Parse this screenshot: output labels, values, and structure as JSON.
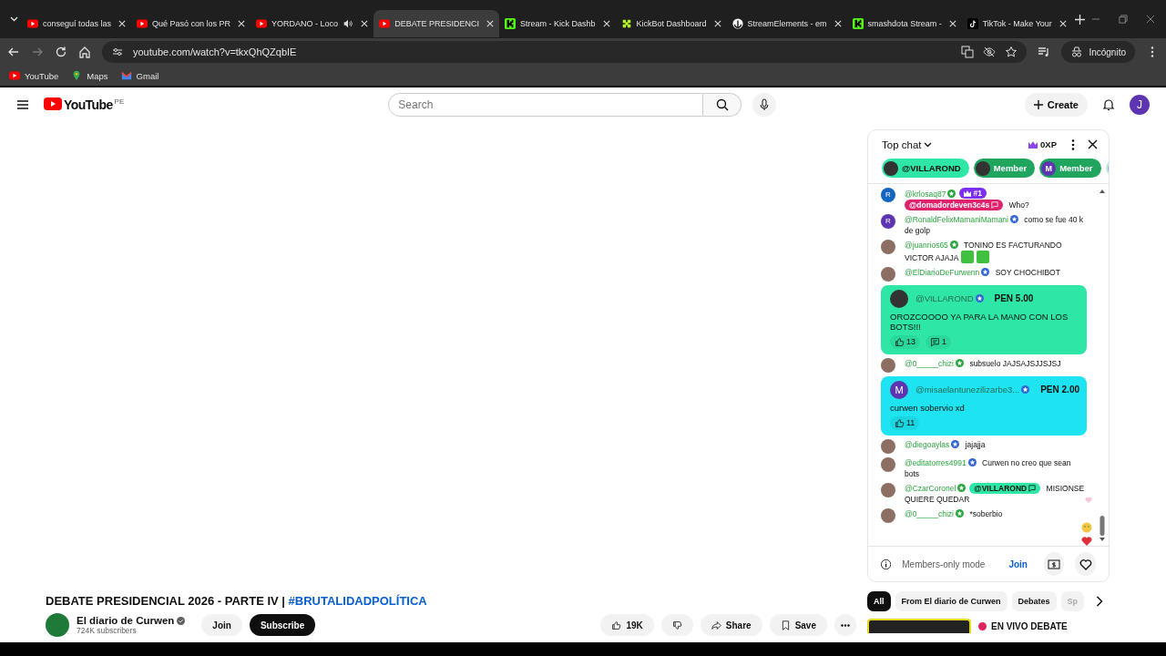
{
  "browser": {
    "tabs": [
      {
        "title": "conseguí todas las",
        "kind": "youtube",
        "audio": false,
        "selected": false
      },
      {
        "title": "Qué Pasó con los PR",
        "kind": "youtube",
        "audio": false,
        "selected": false
      },
      {
        "title": "YORDANO - Loco",
        "kind": "youtube",
        "audio": true,
        "selected": false
      },
      {
        "title": "DEBATE PRESIDENCI",
        "kind": "youtube",
        "audio": false,
        "selected": true
      },
      {
        "title": "Stream - Kick Dashb",
        "kind": "kick",
        "audio": false,
        "selected": false
      },
      {
        "title": "KickBot Dashboard",
        "kind": "kickbot",
        "audio": false,
        "selected": false
      },
      {
        "title": "StreamElements - em",
        "kind": "streamelements",
        "audio": false,
        "selected": false
      },
      {
        "title": "smashdota Stream -",
        "kind": "kick",
        "audio": false,
        "selected": false
      },
      {
        "title": "TikTok - Make Your",
        "kind": "tiktok",
        "audio": false,
        "selected": false
      }
    ],
    "url": "youtube.com/watch?v=tkxQhQZqbIE",
    "profile": "Incógnito",
    "bookmarks": [
      {
        "label": "YouTube",
        "kind": "youtube"
      },
      {
        "label": "Maps",
        "kind": "maps"
      },
      {
        "label": "Gmail",
        "kind": "gmail"
      }
    ]
  },
  "header": {
    "logo": "YouTube",
    "region": "PE",
    "search_placeholder": "Search",
    "create": "Create",
    "avatar_letter": "J"
  },
  "chat": {
    "title": "Top chat",
    "xp": "0XP",
    "pinned": [
      {
        "label": "@VILLAROND"
      },
      {
        "label": "Member"
      },
      {
        "label": "Member",
        "avatar_letter": "M"
      }
    ],
    "messages": [
      {
        "kind": "text",
        "author": "@krlosaq87",
        "member": true,
        "avatar": {
          "letter": "R",
          "color": "#1565c0"
        },
        "rank": "#1",
        "mention": {
          "label": "@domadordeven3c4s",
          "color": "#e0216b"
        },
        "text": "Who?"
      },
      {
        "kind": "text",
        "author": "@RonaldFelixMamaniMamani",
        "member": false,
        "avatar": {
          "letter": "R",
          "color": "#5e35b1"
        },
        "text": "como se fue 40 k de golp"
      },
      {
        "kind": "text",
        "author": "@juanrios65",
        "member": true,
        "text": "TONINO ES FACTURANDO VICTOR AJAJA",
        "emotes": true
      },
      {
        "kind": "text",
        "author": "@ElDiarioDeFurwenn",
        "member": false,
        "text": "SOY CHOCHIBOT"
      },
      {
        "kind": "superchat",
        "author": "@VILLAROND",
        "member": false,
        "amount": "PEN 5.00",
        "color": "#2ee6a6",
        "text": "OROZCOOOO YA PARA LA MANO CON LOS BOTS!!!",
        "likes": "13",
        "replies": "1"
      },
      {
        "kind": "text",
        "author": "@0_____chizi",
        "member": true,
        "text": "subsuelo JAJSAJSJJSJSJ"
      },
      {
        "kind": "superchat",
        "author": "@misaelantunezilizarbe3...",
        "member": false,
        "avatar": {
          "letter": "M",
          "color": "#5e35b1"
        },
        "amount": "PEN 2.00",
        "color": "#1de4f0",
        "text": "curwen sobervio xd",
        "likes": "11"
      },
      {
        "kind": "text",
        "author": "@diegoaylas",
        "member": false,
        "text": "jajajja"
      },
      {
        "kind": "text",
        "author": "@editatorres4991",
        "member": false,
        "text": "Curwen no creo que sean bots"
      },
      {
        "kind": "text",
        "author": "@CzarCoronel",
        "member": true,
        "mention": {
          "label": "@VILLAROND",
          "color": "#2ee6a6"
        },
        "text": "MISIONSE QUIERE QUEDAR"
      },
      {
        "kind": "text",
        "author": "@0_____chizi",
        "member": true,
        "text": "*soberbio"
      }
    ],
    "footer": {
      "mode": "Members-only mode",
      "join": "Join"
    }
  },
  "video": {
    "title": "DEBATE PRESIDENCIAL 2026 - PARTE IV | ",
    "hashtag": "#BRUTALIDADPOLÍTICA",
    "channel": "El diario de Curwen",
    "subscribers": "724K subscribers",
    "join": "Join",
    "subscribe": "Subscribe",
    "likes": "19K",
    "share": "Share",
    "save": "Save"
  },
  "related": {
    "chips": [
      {
        "label": "All",
        "selected": true
      },
      {
        "label": "From El diario de Curwen",
        "selected": false
      },
      {
        "label": "Debates",
        "selected": false
      },
      {
        "label": "Sp",
        "selected": false
      }
    ],
    "item_title": "EN VIVO DEBATE"
  }
}
